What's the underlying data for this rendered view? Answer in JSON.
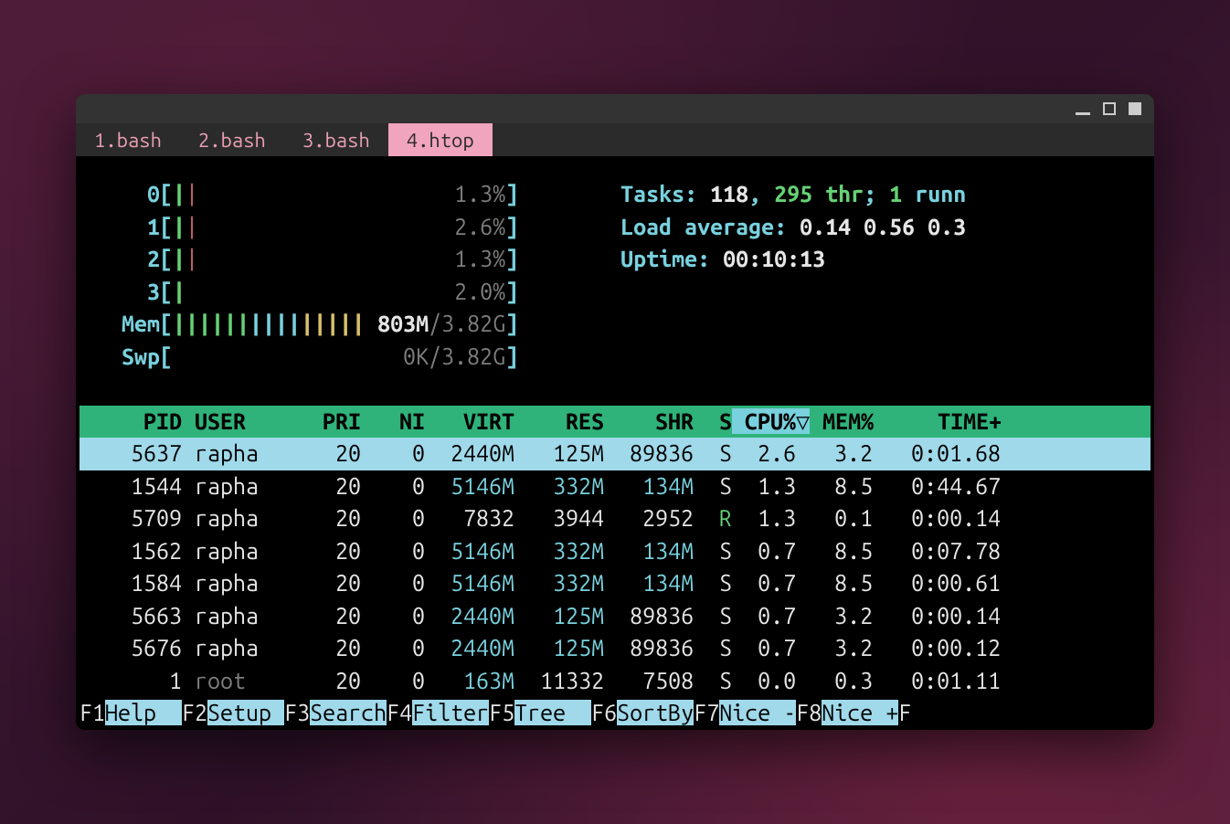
{
  "tabs": [
    "1.bash",
    "2.bash",
    "3.bash",
    "4.htop"
  ],
  "active_tab": 3,
  "cpus": [
    {
      "label": "0",
      "bars": "||",
      "pct": "1.3%"
    },
    {
      "label": "1",
      "bars": "||",
      "pct": "2.6%"
    },
    {
      "label": "2",
      "bars": "||",
      "pct": "1.3%"
    },
    {
      "label": "3",
      "bars": "|",
      "pct": "2.0%"
    }
  ],
  "mem": {
    "label": "Mem",
    "bars": "|||||||||||||||",
    "used": "803M",
    "total": "3.82G"
  },
  "swp": {
    "label": "Swp",
    "used": "0K",
    "total": "3.82G"
  },
  "tasks": {
    "label": "Tasks:",
    "count": "118",
    "thr": "295 thr",
    "run_n": "1",
    "run_w": "runn"
  },
  "load": {
    "label": "Load average:",
    "vals": "0.14 0.56 0.3"
  },
  "uptime": {
    "label": "Uptime:",
    "val": "00:10:13"
  },
  "columns": [
    "PID",
    "USER",
    "PRI",
    "NI",
    "VIRT",
    "RES",
    "SHR",
    "S",
    "CPU%",
    "MEM%",
    "TIME+"
  ],
  "sort_indicator": "▽",
  "rows": [
    {
      "sel": true,
      "pid": "5637",
      "user": "rapha",
      "pri": "20",
      "ni": "0",
      "virt": "2440M",
      "res": "125M",
      "shr": "89836",
      "s": "S",
      "cpu": "2.6",
      "mem": "3.2",
      "time": "0:01.68",
      "root": false,
      "r": false,
      "cvirt": false,
      "cres": false,
      "cshr": false
    },
    {
      "sel": false,
      "pid": "1544",
      "user": "rapha",
      "pri": "20",
      "ni": "0",
      "virt": "5146M",
      "res": "332M",
      "shr": "134M",
      "s": "S",
      "cpu": "1.3",
      "mem": "8.5",
      "time": "0:44.67",
      "root": false,
      "r": false,
      "cvirt": true,
      "cres": true,
      "cshr": true
    },
    {
      "sel": false,
      "pid": "5709",
      "user": "rapha",
      "pri": "20",
      "ni": "0",
      "virt": "7832",
      "res": "3944",
      "shr": "2952",
      "s": "R",
      "cpu": "1.3",
      "mem": "0.1",
      "time": "0:00.14",
      "root": false,
      "r": true,
      "cvirt": false,
      "cres": false,
      "cshr": false
    },
    {
      "sel": false,
      "pid": "1562",
      "user": "rapha",
      "pri": "20",
      "ni": "0",
      "virt": "5146M",
      "res": "332M",
      "shr": "134M",
      "s": "S",
      "cpu": "0.7",
      "mem": "8.5",
      "time": "0:07.78",
      "root": false,
      "r": false,
      "cvirt": true,
      "cres": true,
      "cshr": true
    },
    {
      "sel": false,
      "pid": "1584",
      "user": "rapha",
      "pri": "20",
      "ni": "0",
      "virt": "5146M",
      "res": "332M",
      "shr": "134M",
      "s": "S",
      "cpu": "0.7",
      "mem": "8.5",
      "time": "0:00.61",
      "root": false,
      "r": false,
      "cvirt": true,
      "cres": true,
      "cshr": true
    },
    {
      "sel": false,
      "pid": "5663",
      "user": "rapha",
      "pri": "20",
      "ni": "0",
      "virt": "2440M",
      "res": "125M",
      "shr": "89836",
      "s": "S",
      "cpu": "0.7",
      "mem": "3.2",
      "time": "0:00.14",
      "root": false,
      "r": false,
      "cvirt": true,
      "cres": true,
      "cshr": false
    },
    {
      "sel": false,
      "pid": "5676",
      "user": "rapha",
      "pri": "20",
      "ni": "0",
      "virt": "2440M",
      "res": "125M",
      "shr": "89836",
      "s": "S",
      "cpu": "0.7",
      "mem": "3.2",
      "time": "0:00.12",
      "root": false,
      "r": false,
      "cvirt": true,
      "cres": true,
      "cshr": false
    },
    {
      "sel": false,
      "pid": "1",
      "user": "root",
      "pri": "20",
      "ni": "0",
      "virt": "163M",
      "res": "11332",
      "shr": "7508",
      "s": "S",
      "cpu": "0.0",
      "mem": "0.3",
      "time": "0:01.11",
      "root": true,
      "r": false,
      "cvirt": true,
      "cres": false,
      "cshr": false
    }
  ],
  "fkeys": [
    {
      "k": "F1",
      "l": "Help  "
    },
    {
      "k": "F2",
      "l": "Setup "
    },
    {
      "k": "F3",
      "l": "Search"
    },
    {
      "k": "F4",
      "l": "Filter"
    },
    {
      "k": "F5",
      "l": "Tree  "
    },
    {
      "k": "F6",
      "l": "SortBy"
    },
    {
      "k": "F7",
      "l": "Nice -"
    },
    {
      "k": "F8",
      "l": "Nice +"
    }
  ]
}
